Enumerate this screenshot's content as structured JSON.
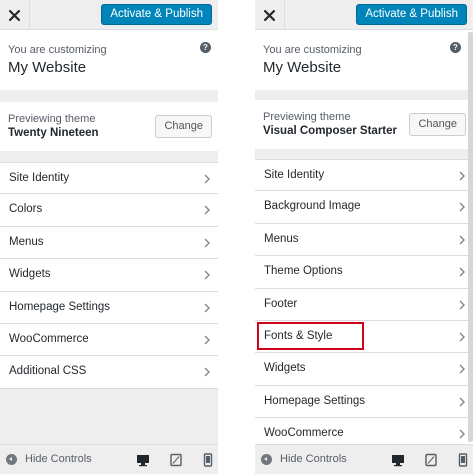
{
  "left": {
    "publish_label": "Activate & Publish",
    "customizing_label": "You are customizing",
    "site_title": "My Website",
    "theme_label": "Previewing theme",
    "theme_name": "Twenty Nineteen",
    "change_label": "Change",
    "menu": [
      {
        "label": "Site Identity"
      },
      {
        "label": "Colors"
      },
      {
        "label": "Menus"
      },
      {
        "label": "Widgets"
      },
      {
        "label": "Homepage Settings"
      },
      {
        "label": "WooCommerce"
      },
      {
        "label": "Additional CSS"
      }
    ],
    "hide_controls": "Hide Controls"
  },
  "right": {
    "publish_label": "Activate & Publish",
    "customizing_label": "You are customizing",
    "site_title": "My Website",
    "theme_label": "Previewing theme",
    "theme_name": "Visual Composer Starter",
    "change_label": "Change",
    "menu": [
      {
        "label": "Site Identity"
      },
      {
        "label": "Background Image"
      },
      {
        "label": "Menus"
      },
      {
        "label": "Theme Options"
      },
      {
        "label": "Footer"
      },
      {
        "label": "Fonts & Style",
        "highlighted": true
      },
      {
        "label": "Widgets"
      },
      {
        "label": "Homepage Settings"
      },
      {
        "label": "WooCommerce"
      }
    ],
    "hide_controls": "Hide Controls"
  },
  "icons": {
    "close": "close-icon",
    "help": "help-icon",
    "chevron": "chevron-right-icon",
    "hide_controls": "collapse-icon",
    "desktop": "desktop-icon",
    "tablet": "tablet-icon",
    "mobile": "mobile-icon"
  },
  "colors": {
    "accent": "#0085ba",
    "panel_bg": "#eeeeee",
    "highlight": "#d0021b"
  }
}
